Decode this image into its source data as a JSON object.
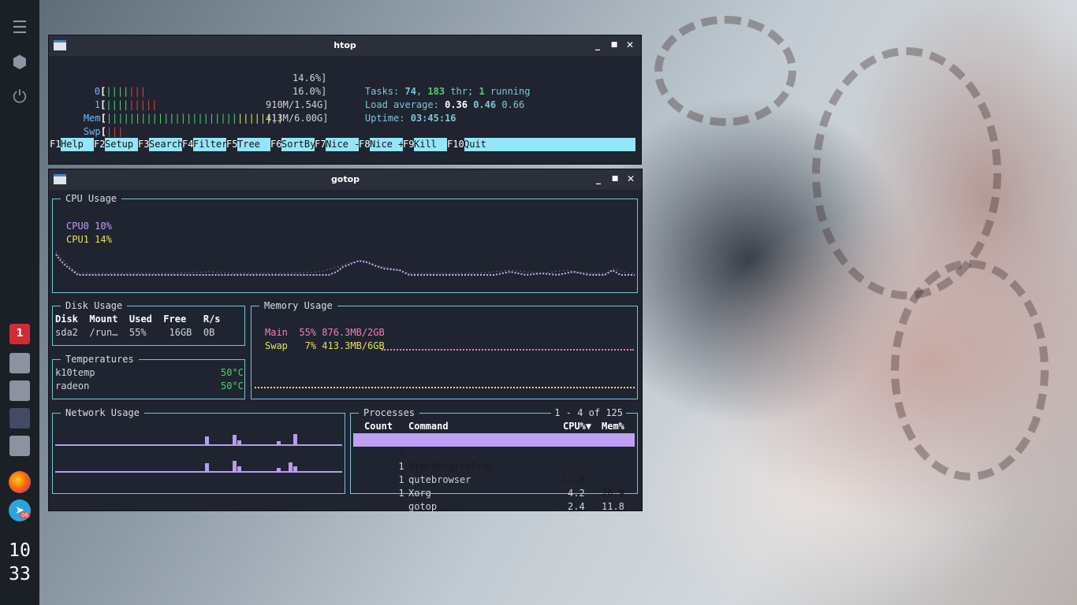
{
  "dock": {
    "icons": [
      "hamburger-menu-icon",
      "package-box-icon",
      "power-icon"
    ],
    "workspace_badge": "1",
    "tray": [
      "firefox-icon",
      "telegram-icon"
    ],
    "telegram_badge": "06",
    "clock_hour": "10",
    "clock_minute": "33",
    "colors": {
      "dock_bg": "#1b1f26",
      "badge_red": "#d02c38"
    }
  },
  "htop": {
    "title": "htop",
    "cpu_rows": [
      {
        "label": "0",
        "bar": "||||",
        "bar_red": "|||",
        "value": "14.6%]"
      },
      {
        "label": "1",
        "bar": "||||",
        "bar_red": "|||||",
        "value": "16.0%]"
      }
    ],
    "mem": {
      "label": "Mem",
      "bar": "|||||||||||||||||||||||",
      "bar2": "||||||||",
      "value": "910M/1.54G]"
    },
    "swp": {
      "label": "Swp",
      "bar_red": "|||",
      "value": "413M/6.00G]"
    },
    "tasks": {
      "label": "Tasks:",
      "count": "74",
      "thr": "183",
      "thr_label": " thr;",
      "running": "1",
      "running_label": " running"
    },
    "load": {
      "label": "Load average:",
      "v1": "0.36",
      "v2": "0.46",
      "v3": "0.66"
    },
    "uptime": {
      "label": "Uptime:",
      "value": "03:45:16"
    },
    "fkeys": [
      {
        "num": "F1",
        "label": "Help  "
      },
      {
        "num": "F2",
        "label": "Setup "
      },
      {
        "num": "F3",
        "label": "Search"
      },
      {
        "num": "F4",
        "label": "Filter"
      },
      {
        "num": "F5",
        "label": "Tree  "
      },
      {
        "num": "F6",
        "label": "SortBy"
      },
      {
        "num": "F7",
        "label": "Nice -"
      },
      {
        "num": "F8",
        "label": "Nice +"
      },
      {
        "num": "F9",
        "label": "Kill  "
      },
      {
        "num": "F10",
        "label": "Quit"
      }
    ]
  },
  "gotop": {
    "title": "gotop",
    "cpu": {
      "title": "CPU Usage",
      "cpu0": "CPU0 10%",
      "cpu1": "CPU1 14%"
    },
    "disk": {
      "title": "Disk Usage",
      "header": "Disk  Mount  Used  Free   R/s",
      "row": "sda2  /run…  55%    16GB  0B"
    },
    "temps": {
      "title": "Temperatures",
      "rows": [
        {
          "name": "k10temp",
          "value": "50°C"
        },
        {
          "name": "radeon",
          "value": "50°C"
        }
      ]
    },
    "memory": {
      "title": "Memory Usage",
      "main": "Main  55% 876.3MB/2GB",
      "swap": "Swap   7% 413.3MB/6GB"
    },
    "network": {
      "title": "Network Usage"
    },
    "processes": {
      "title": "Processes",
      "range": "1 - 4 of 125",
      "headers": {
        "count": "Count",
        "command": "Command",
        "cpu": "CPU%▼",
        "mem": "Mem%"
      },
      "rows": [
        {
          "count": "7",
          "command": "QtWebEngineProc",
          "cpu": "11.8",
          "mem": "26.9"
        },
        {
          "count": "1",
          "command": "qutebrowser",
          "cpu": "4.2",
          "mem": "11.8"
        },
        {
          "count": "1",
          "command": "Xorg",
          "cpu": "2.4",
          "mem": "2.5"
        },
        {
          "count": "1",
          "command": "gotop",
          "cpu": "2.4",
          "mem": "0.8"
        }
      ]
    },
    "colors": {
      "border": "#73c7d8",
      "accent": "#bfa0f5",
      "main": "#f080b8",
      "swap": "#e8e05a"
    }
  },
  "window_controls": {
    "minimize": "‗",
    "maximize": "■",
    "close": "✕"
  }
}
